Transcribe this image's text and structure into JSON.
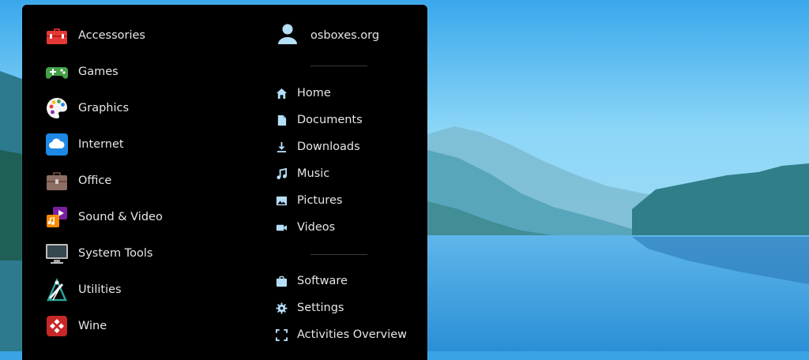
{
  "colors": {
    "panel": "#000000",
    "text": "#e6e6e6",
    "icon_blue": "#b5def7",
    "sky": "#3aa3e6"
  },
  "categories": [
    {
      "label": "Accessories",
      "icon": "toolbox-icon"
    },
    {
      "label": "Games",
      "icon": "gamepad-icon"
    },
    {
      "label": "Graphics",
      "icon": "palette-icon"
    },
    {
      "label": "Internet",
      "icon": "cloud-icon"
    },
    {
      "label": "Office",
      "icon": "briefcase-icon"
    },
    {
      "label": "Sound & Video",
      "icon": "music-video-icon"
    },
    {
      "label": "System Tools",
      "icon": "monitor-icon"
    },
    {
      "label": "Utilities",
      "icon": "drafting-tools-icon"
    },
    {
      "label": "Wine",
      "icon": "wine-icon"
    }
  ],
  "user": {
    "name": "osboxes.org",
    "icon": "user-icon"
  },
  "places": [
    {
      "label": "Home",
      "icon": "home-icon"
    },
    {
      "label": "Documents",
      "icon": "document-icon"
    },
    {
      "label": "Downloads",
      "icon": "download-icon"
    },
    {
      "label": "Music",
      "icon": "music-note-icon"
    },
    {
      "label": "Pictures",
      "icon": "image-icon"
    },
    {
      "label": "Videos",
      "icon": "video-camera-icon"
    }
  ],
  "system": [
    {
      "label": "Software",
      "icon": "software-bag-icon"
    },
    {
      "label": "Settings",
      "icon": "gear-icon"
    },
    {
      "label": "Activities Overview",
      "icon": "activities-icon"
    }
  ]
}
